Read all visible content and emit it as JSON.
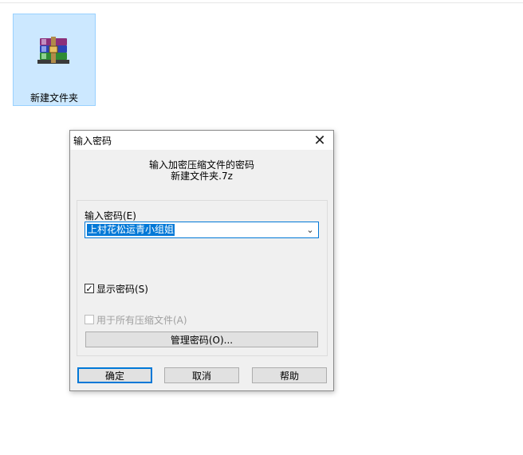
{
  "desktop": {
    "folder_label": "新建文件夹",
    "folder_icon": "winrar-archive-icon"
  },
  "dialog": {
    "title": "输入密码",
    "close_glyph": "✕",
    "header_line1": "输入加密压缩文件的密码",
    "header_line2": "新建文件夹.7z",
    "password_label": "输入密码(E)",
    "password_value": "上村花松运青小组姐",
    "show_password_label": "显示密码(S)",
    "show_password_checked": true,
    "use_all_label": "用于所有压缩文件(A)",
    "use_all_checked": false,
    "manage_button": "管理密码(O)...",
    "ok_button": "确定",
    "cancel_button": "取消",
    "help_button": "帮助"
  }
}
